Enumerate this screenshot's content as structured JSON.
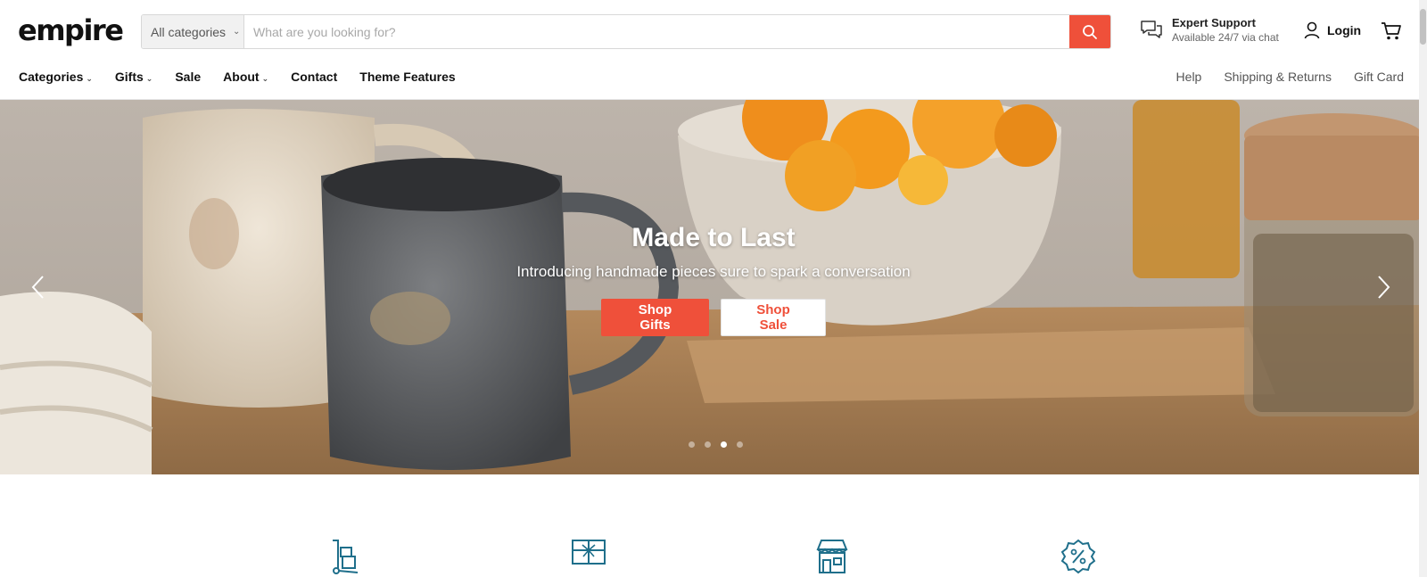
{
  "brand": {
    "logo_text": "empire",
    "accent_color": "#ef503a"
  },
  "search": {
    "category_value": "All categories",
    "placeholder": "What are you looking for?",
    "button_icon": "search-icon"
  },
  "support": {
    "title": "Expert Support",
    "subtitle": "Available 24/7 via chat",
    "icon": "chat-bubbles-icon"
  },
  "account": {
    "login_label": "Login",
    "icon": "user-icon"
  },
  "cart": {
    "icon": "cart-icon"
  },
  "nav": {
    "left": [
      {
        "label": "Categories",
        "dropdown": true
      },
      {
        "label": "Gifts",
        "dropdown": true
      },
      {
        "label": "Sale",
        "dropdown": false
      },
      {
        "label": "About",
        "dropdown": true
      },
      {
        "label": "Contact",
        "dropdown": false
      },
      {
        "label": "Theme Features",
        "dropdown": false
      }
    ],
    "right": [
      {
        "label": "Help"
      },
      {
        "label": "Shipping & Returns"
      },
      {
        "label": "Gift Card"
      }
    ]
  },
  "hero": {
    "title": "Made to Last",
    "subtitle": "Introducing handmade pieces sure to spark a conversation",
    "primary_button": "Shop Gifts",
    "secondary_button": "Shop Sale",
    "slide_count": 4,
    "active_slide": 3
  },
  "features": [
    {
      "icon": "hand-truck-icon"
    },
    {
      "icon": "gift-card-icon"
    },
    {
      "icon": "storefront-icon"
    },
    {
      "icon": "discount-badge-icon"
    }
  ]
}
